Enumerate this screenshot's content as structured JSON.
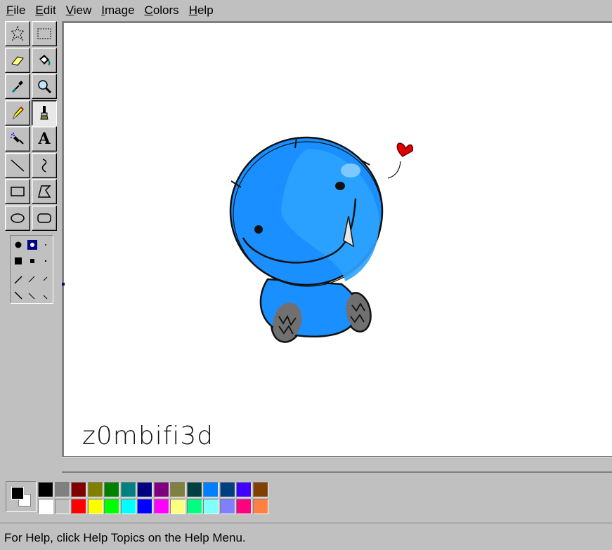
{
  "menubar": {
    "items": [
      {
        "label": "File",
        "accel": "F",
        "rest": "ile"
      },
      {
        "label": "Edit",
        "accel": "E",
        "rest": "dit"
      },
      {
        "label": "View",
        "accel": "V",
        "rest": "iew"
      },
      {
        "label": "Image",
        "accel": "I",
        "rest": "mage"
      },
      {
        "label": "Colors",
        "accel": "C",
        "rest": "olors"
      },
      {
        "label": "Help",
        "accel": "H",
        "rest": "elp"
      }
    ]
  },
  "toolbox": {
    "tools": [
      {
        "name": "free-form-select",
        "icon": "free-select-icon",
        "active": false
      },
      {
        "name": "rect-select",
        "icon": "rect-select-icon",
        "active": false
      },
      {
        "name": "eraser",
        "icon": "eraser-icon",
        "active": false
      },
      {
        "name": "fill",
        "icon": "fill-bucket-icon",
        "active": false
      },
      {
        "name": "pick-color",
        "icon": "eyedropper-icon",
        "active": false
      },
      {
        "name": "magnifier",
        "icon": "magnifier-icon",
        "active": false
      },
      {
        "name": "pencil",
        "icon": "pencil-icon",
        "active": false
      },
      {
        "name": "brush",
        "icon": "brush-icon",
        "active": true
      },
      {
        "name": "airbrush",
        "icon": "airbrush-icon",
        "active": false
      },
      {
        "name": "text",
        "icon": "text-icon",
        "active": false,
        "glyph": "A"
      },
      {
        "name": "line",
        "icon": "line-icon",
        "active": false
      },
      {
        "name": "curve",
        "icon": "curve-icon",
        "active": false
      },
      {
        "name": "rectangle",
        "icon": "rectangle-icon",
        "active": false
      },
      {
        "name": "polygon",
        "icon": "polygon-icon",
        "active": false
      },
      {
        "name": "ellipse",
        "icon": "ellipse-icon",
        "active": false
      },
      {
        "name": "rounded-rectangle",
        "icon": "rounded-rect-icon",
        "active": false
      }
    ]
  },
  "canvas": {
    "signature": "z0mbifi3d"
  },
  "palette": {
    "foreground": "#000000",
    "background": "#ffffff",
    "top_row": [
      "#000000",
      "#808080",
      "#800000",
      "#808000",
      "#008000",
      "#008080",
      "#000080",
      "#800080",
      "#808040",
      "#004040",
      "#0080ff",
      "#004080",
      "#4000ff",
      "#804000"
    ],
    "bottom_row": [
      "#ffffff",
      "#c0c0c0",
      "#ff0000",
      "#ffff00",
      "#00ff00",
      "#00ffff",
      "#0000ff",
      "#ff00ff",
      "#ffff80",
      "#00ff80",
      "#80ffff",
      "#8080ff",
      "#ff0080",
      "#ff8040"
    ]
  },
  "statusbar": {
    "text": "For Help, click Help Topics on the Help Menu."
  }
}
